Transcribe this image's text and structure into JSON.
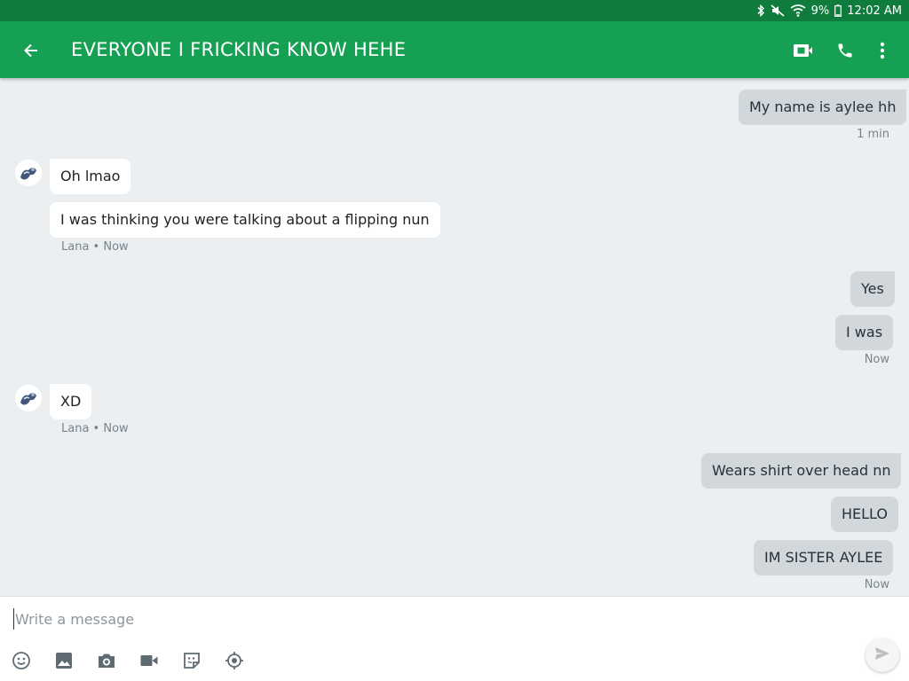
{
  "status_bar": {
    "battery": "9%",
    "time": "12:02 AM",
    "icons": [
      "bluetooth-icon",
      "mute-icon",
      "wifi-icon",
      "battery-icon"
    ]
  },
  "app_bar": {
    "title": "EVERYONE I FRICKING KNOW HEHE",
    "icons": [
      "back-arrow-icon",
      "video-call-icon",
      "phone-icon",
      "more-vert-icon"
    ],
    "color": "#16a053",
    "status_color": "#0f7c3e"
  },
  "conversation": {
    "messages": [
      {
        "from": "me",
        "text": "My name is aylee hh"
      },
      {
        "from": "me",
        "meta": "1 min"
      },
      {
        "from": "Lana",
        "text": "Oh lmao"
      },
      {
        "from": "Lana",
        "text": "I was thinking you were talking about a flipping nun"
      },
      {
        "from": "Lana",
        "meta": "Lana • Now"
      },
      {
        "from": "me",
        "text": "Yes"
      },
      {
        "from": "me",
        "text": "I was"
      },
      {
        "from": "me",
        "meta": "Now"
      },
      {
        "from": "Lana",
        "text": "XD"
      },
      {
        "from": "Lana",
        "meta": "Lana • Now"
      },
      {
        "from": "me",
        "text": "Wears shirt over head nn"
      },
      {
        "from": "me",
        "text": "HELLO"
      },
      {
        "from": "me",
        "text": "IM SISTER AYLEE"
      },
      {
        "from": "me",
        "meta": "Now"
      }
    ]
  },
  "composer": {
    "placeholder": "Write a message",
    "tools": [
      "emoji-icon",
      "image-icon",
      "camera-icon",
      "video-icon",
      "sticker-icon",
      "location-icon"
    ],
    "send_icon": "send-icon"
  }
}
